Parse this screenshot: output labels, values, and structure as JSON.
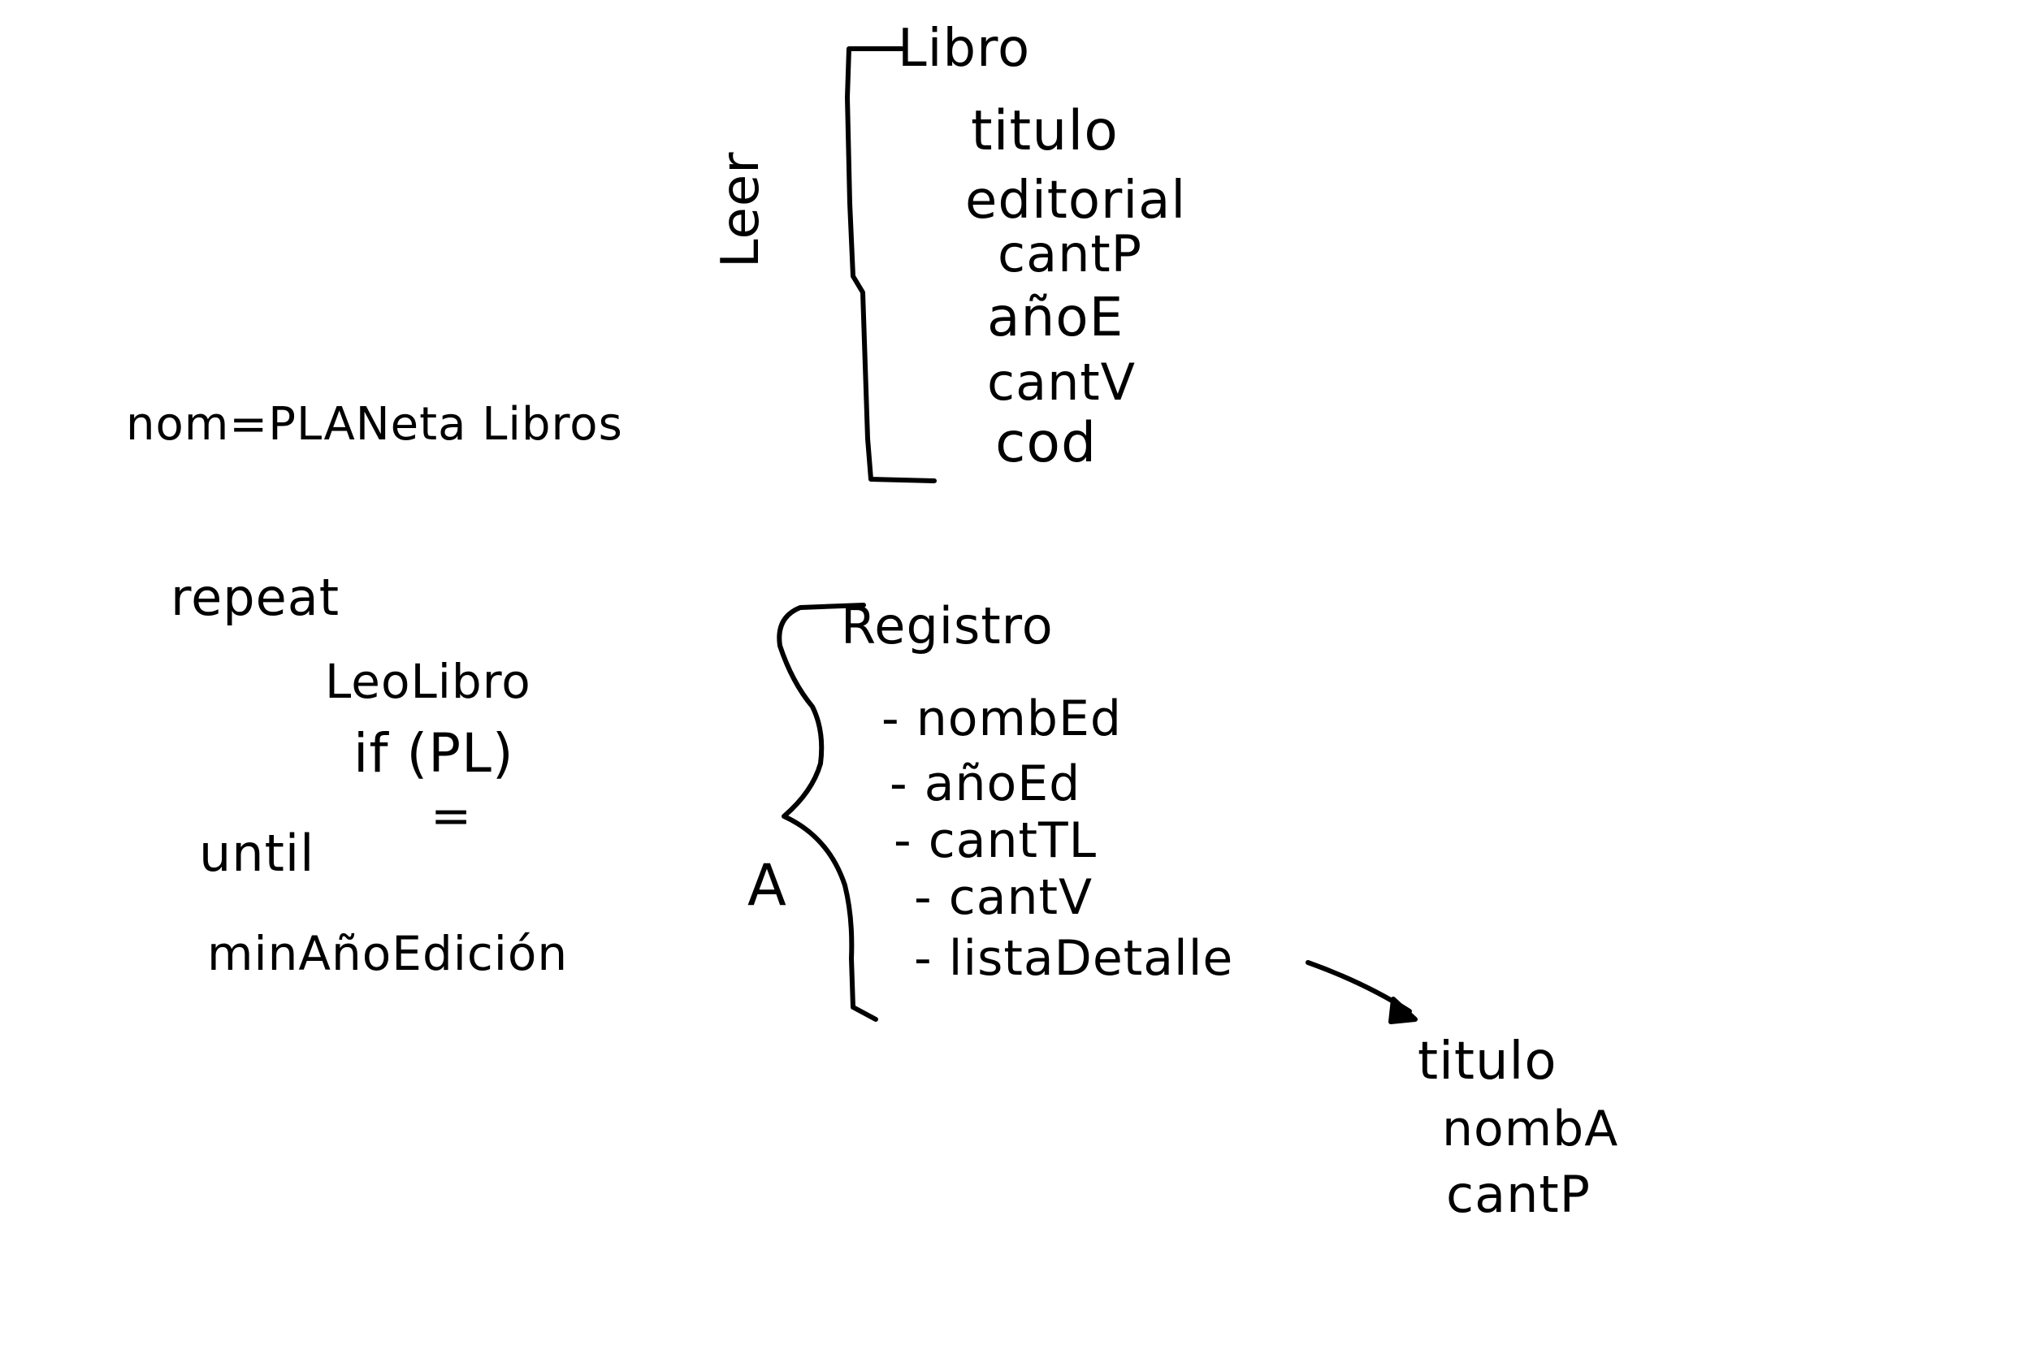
{
  "libro": {
    "title": "Libro",
    "fields": [
      "titulo",
      "editorial",
      "cantP",
      "añoE",
      "cantV",
      "cod"
    ]
  },
  "leer_label": "Leer",
  "nom_label": "nom=PLANeta Libros",
  "loop": {
    "repeat": "repeat",
    "body_call": "LeoLibro",
    "condition": "if (PL)",
    "equals": "=",
    "until": "until",
    "result": "minAñoEdición"
  },
  "registro": {
    "title": "Registro",
    "fields": [
      "- nombEd",
      "- añoEd",
      "- cantTL",
      "- cantV",
      "- listaDetalle"
    ],
    "side_label": "A"
  },
  "detalle": {
    "fields": [
      "titulo",
      "nombA",
      "cantP"
    ]
  },
  "ink_color": "#000000",
  "background_color": "#ffffff"
}
